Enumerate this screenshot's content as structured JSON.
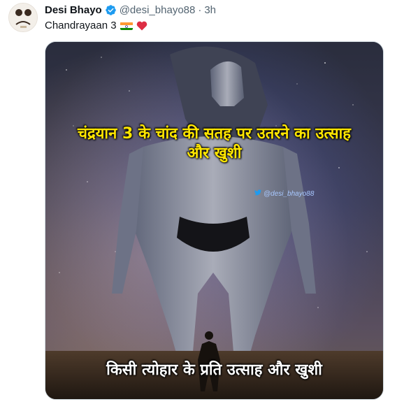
{
  "author": {
    "display_name": "Desi Bhayo",
    "handle": "@desi_bhayo88",
    "separator": "·",
    "time": "3h",
    "verified": true
  },
  "tweet": {
    "text": "Chandrayaan 3"
  },
  "meme": {
    "top_caption": "चंद्रयान 3 के चांद की सतह पर उतरने का उत्साह और खुशी",
    "bottom_caption": "किसी त्योहार के प्रति उत्साह और खुशी",
    "watermark": "@desi_bhayo88"
  },
  "colors": {
    "verified": "#1d9bf0",
    "caption_top": "#ffe600",
    "caption_bottom": "#ffffff",
    "heart": "#e0245e"
  }
}
